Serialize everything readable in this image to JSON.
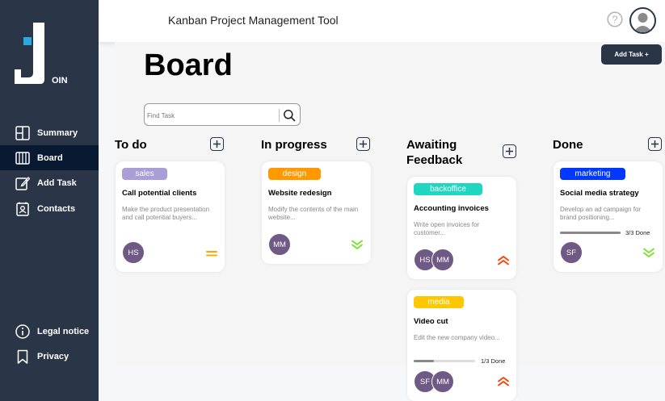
{
  "header": {
    "title": "Kanban Project Management Tool"
  },
  "logo": {
    "text": "OIN"
  },
  "sidebar": {
    "items": [
      {
        "label": "Summary",
        "icon": "summary-icon"
      },
      {
        "label": "Board",
        "icon": "board-icon",
        "active": true
      },
      {
        "label": "Add Task",
        "icon": "add-task-icon"
      },
      {
        "label": "Contacts",
        "icon": "contacts-icon"
      }
    ],
    "footer": [
      {
        "label": "Legal notice",
        "icon": "info-icon"
      },
      {
        "label": "Privacy",
        "icon": "bookmark-icon"
      }
    ]
  },
  "main": {
    "title": "Board",
    "add_task_label": "Add Task +",
    "search": {
      "placeholder": "Find Task"
    }
  },
  "columns": [
    {
      "title": "To do",
      "cards": [
        {
          "tag": "sales",
          "tag_color": "#a99ed5",
          "title": "Call potential clients",
          "desc": "Make the product presentation and call potential buyers...",
          "avatars": [
            "HS"
          ],
          "priority": "medium"
        }
      ]
    },
    {
      "title": "In progress",
      "cards": [
        {
          "tag": "design",
          "tag_color": "#ff9900",
          "title": "Website redesign",
          "desc": "Modify the contents of the main website...",
          "avatars": [
            "MM"
          ],
          "priority": "low"
        }
      ]
    },
    {
      "title": "Awaiting Feedback",
      "cards": [
        {
          "tag": "backoffice",
          "tag_color": "#1fd7c1",
          "title": "Accounting invoices",
          "desc": "Write open invoices for customer...",
          "avatars": [
            "HS",
            "MM"
          ],
          "priority": "urgent"
        },
        {
          "tag": "media",
          "tag_color": "#ffc701",
          "title": "Video cut",
          "desc": "Edit the new company video...",
          "progress": 0.33,
          "progress_text": "1/3 Done",
          "avatars": [
            "SF",
            "MM"
          ],
          "priority": "urgent"
        }
      ]
    },
    {
      "title": "Done",
      "cards": [
        {
          "tag": "marketing",
          "tag_color": "#0038ff",
          "title": "Social media strategy",
          "desc": "Develop an ad campaign for brand positioning...",
          "progress": 1.0,
          "progress_text": "3/3 Done",
          "avatars": [
            "SF"
          ],
          "priority": "low"
        }
      ]
    }
  ],
  "colors": {
    "sidebar": "#2a3647",
    "sidebar_active": "#091931",
    "logo_accent": "#29abe2",
    "priority_low": "#7ae229",
    "priority_medium": "#ffa800",
    "priority_urgent": "#ff3d00",
    "avatar": "#6e5a84"
  }
}
